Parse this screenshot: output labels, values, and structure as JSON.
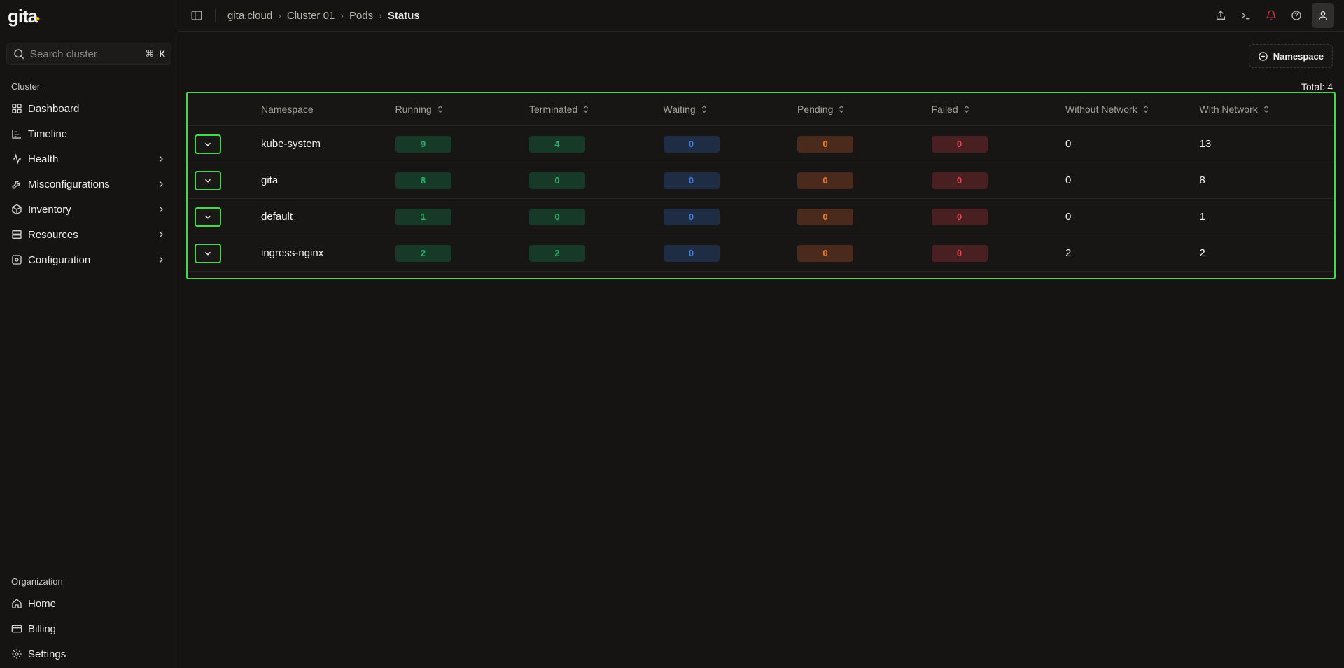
{
  "brand": {
    "name": "gita"
  },
  "search": {
    "placeholder": "Search cluster",
    "shortcut_symbol": "⌘",
    "shortcut_key": "K"
  },
  "sidebar": {
    "cluster_label": "Cluster",
    "items": [
      {
        "label": "Dashboard",
        "icon": "grid-icon",
        "has_submenu": false
      },
      {
        "label": "Timeline",
        "icon": "timeline-icon",
        "has_submenu": false
      },
      {
        "label": "Health",
        "icon": "activity-icon",
        "has_submenu": true
      },
      {
        "label": "Misconfigurations",
        "icon": "wrench-icon",
        "has_submenu": true
      },
      {
        "label": "Inventory",
        "icon": "box-icon",
        "has_submenu": true
      },
      {
        "label": "Resources",
        "icon": "server-icon",
        "has_submenu": true
      },
      {
        "label": "Configuration",
        "icon": "config-icon",
        "has_submenu": true
      }
    ],
    "organization_label": "Organization",
    "org_items": [
      {
        "label": "Home",
        "icon": "home-icon"
      },
      {
        "label": "Billing",
        "icon": "card-icon"
      },
      {
        "label": "Settings",
        "icon": "gear-icon"
      }
    ]
  },
  "breadcrumb": {
    "items": [
      "gita.cloud",
      "Cluster 01",
      "Pods"
    ],
    "current": "Status"
  },
  "actions": {
    "namespace_button": "Namespace"
  },
  "total_label": "Total: 4",
  "table": {
    "columns": [
      "Namespace",
      "Running",
      "Terminated",
      "Waiting",
      "Pending",
      "Failed",
      "Without Network",
      "With Network"
    ],
    "rows": [
      {
        "namespace": "kube-system",
        "running": "9",
        "terminated": "4",
        "waiting": "0",
        "pending": "0",
        "failed": "0",
        "without_network": "0",
        "with_network": "13"
      },
      {
        "namespace": "gita",
        "running": "8",
        "terminated": "0",
        "waiting": "0",
        "pending": "0",
        "failed": "0",
        "without_network": "0",
        "with_network": "8"
      },
      {
        "namespace": "default",
        "running": "1",
        "terminated": "0",
        "waiting": "0",
        "pending": "0",
        "failed": "0",
        "without_network": "0",
        "with_network": "1"
      },
      {
        "namespace": "ingress-nginx",
        "running": "2",
        "terminated": "2",
        "waiting": "0",
        "pending": "0",
        "failed": "0",
        "without_network": "2",
        "with_network": "2"
      }
    ]
  },
  "colors": {
    "accent_outline": "#43d94a",
    "running": "#2fb06e",
    "waiting": "#3f7ff0",
    "pending": "#ef7a2f",
    "failed": "#e04a52",
    "notification": "#e53935"
  }
}
